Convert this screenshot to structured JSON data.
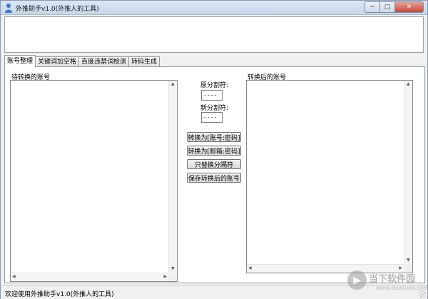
{
  "window": {
    "title": "外推助手v1.0(外推人的工具)",
    "controls": {
      "minimize": "─",
      "maximize": "□",
      "close": "✕"
    }
  },
  "tabs": [
    {
      "label": "账号整理",
      "active": true
    },
    {
      "label": "关键词加空格",
      "active": false
    },
    {
      "label": "百度违禁词检测",
      "active": false
    },
    {
      "label": "转码生成",
      "active": false
    }
  ],
  "main": {
    "left_list_label": "待转换的账号",
    "right_list_label": "转换后的账号",
    "orig_separator_label": "原分割符:",
    "orig_separator_value": "----",
    "new_separator_label": "新分割符:",
    "new_separator_value": "----",
    "buttons": {
      "convert_account": "转换为[账号:密码]",
      "convert_email": "转换为[邮箱:密码]",
      "replace_separator": "只替换分隔符",
      "save_converted": "保存转换后的账号"
    }
  },
  "status": {
    "text": "欢迎使用外推助手v1.0(外推人的工具)"
  },
  "watermark": {
    "title": "当下软件园",
    "subtitle": "www.downxia.com"
  },
  "colors": {
    "titlebar": "#c6d6ea",
    "close_button": "#c6483a",
    "panel_bg": "#ffffff",
    "window_bg": "#f0f0f0"
  }
}
